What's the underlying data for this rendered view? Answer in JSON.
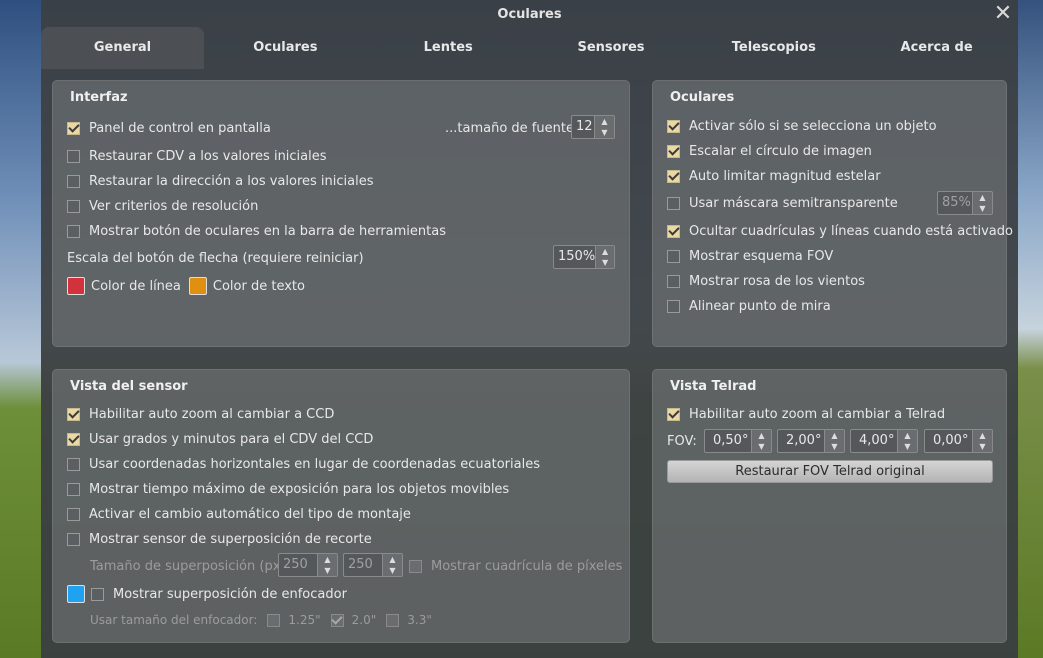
{
  "window": {
    "title": "Oculares"
  },
  "tabs": [
    "General",
    "Oculares",
    "Lentes",
    "Sensores",
    "Telescopios",
    "Acerca de"
  ],
  "interfaz": {
    "title": "Interfaz",
    "panel_control": "Panel de control en pantalla",
    "font_size_label": "...tamaño de fuente",
    "font_size_value": "12",
    "restore_fov": "Restaurar CDV a los valores iniciales",
    "restore_direction": "Restaurar la dirección a los valores iniciales",
    "resolution_criteria": "Ver criterios de resolución",
    "toolbar_button": "Mostrar botón de oculares en la barra de herramientas",
    "arrow_scale_label": "Escala del botón de flecha (requiere reiniciar)",
    "arrow_scale_value": "150%",
    "line_color": "Color de línea",
    "text_color": "Color de texto",
    "line_color_hex": "#d2323c",
    "text_color_hex": "#e09010"
  },
  "oculares": {
    "title": "Oculares",
    "only_selected": "Activar sólo si se selecciona un objeto",
    "scale_circle": "Escalar el círculo de imagen",
    "auto_limit": "Auto limitar magnitud estelar",
    "semi_mask": "Usar máscara semitransparente",
    "semi_mask_value": "85%",
    "hide_grids": "Ocultar cuadrículas y líneas cuando está activado",
    "fov_scheme": "Mostrar esquema FOV",
    "compass_rose": "Mostrar rosa de los vientos",
    "align_crosshair": "Alinear punto de mira"
  },
  "sensor": {
    "title": "Vista del sensor",
    "auto_zoom_ccd": "Habilitar auto zoom al cambiar a CCD",
    "degrees_minutes": "Usar grados y minutos para el CDV del CCD",
    "horizontal_coords": "Usar coordenadas horizontales en lugar de coordenadas ecuatoriales",
    "max_exposure": "Mostrar tiempo máximo de exposición para los objetos movibles",
    "mount_switch": "Activar el cambio automático del tipo de montaje",
    "crop_overlay": "Mostrar sensor de superposición de recorte",
    "overlay_size_label": "Tamaño de superposición (px)",
    "overlay_w": "250",
    "overlay_h": "250",
    "pixel_grid": "Mostrar cuadrícula de píxeles",
    "focuser_overlay": "Mostrar superposición de enfocador",
    "focuser_color_hex": "#1fa3f0",
    "focuser_size_label": "Usar tamaño del enfocador:",
    "focuser_sizes": [
      "1.25\"",
      "2.0\"",
      "3.3\""
    ]
  },
  "telrad": {
    "title": "Vista Telrad",
    "auto_zoom": "Habilitar auto zoom al cambiar a Telrad",
    "fov_label": "FOV:",
    "fov_values": [
      "0,50°",
      "2,00°",
      "4,00°",
      "0,00°"
    ],
    "restore_button": "Restaurar FOV Telrad original"
  }
}
